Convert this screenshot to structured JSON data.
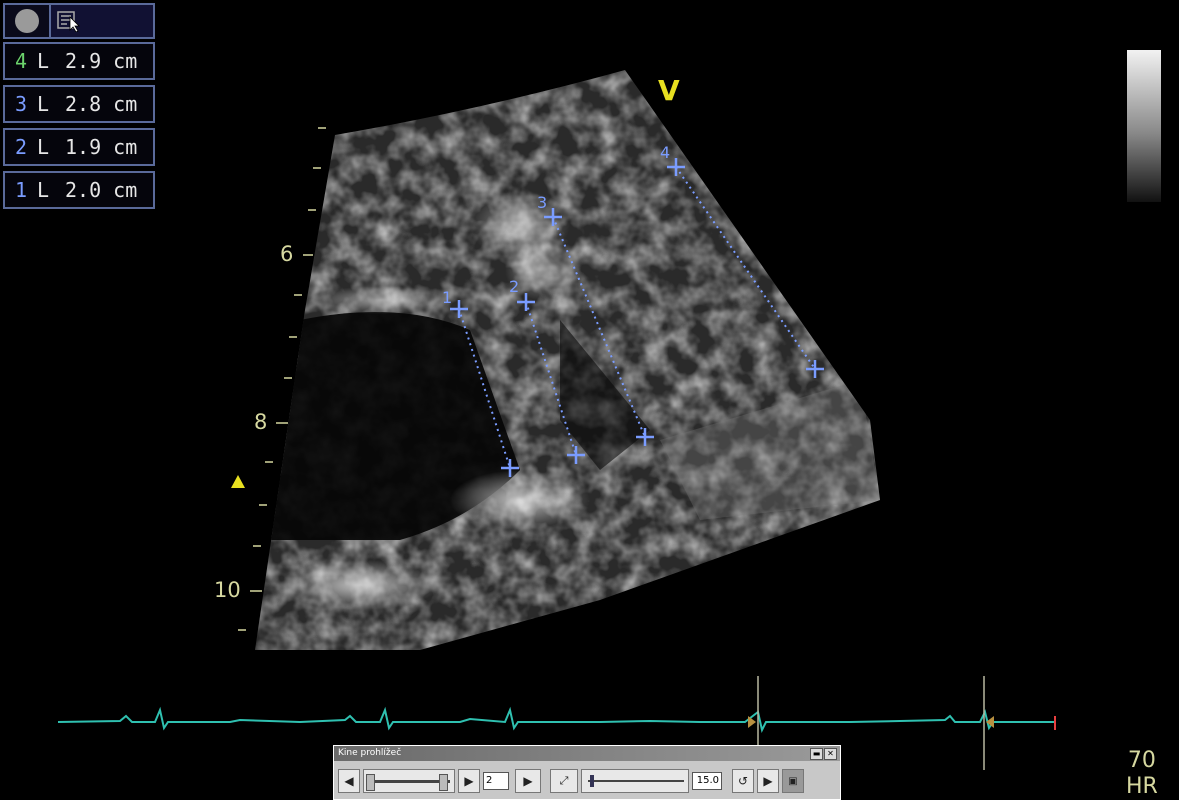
{
  "toolbar": {
    "icons": [
      "record-circle-icon",
      "settings-cursor-icon"
    ]
  },
  "measurements": [
    {
      "index": "4",
      "type": "L",
      "value": "2.9 cm",
      "color": "#6cd36c"
    },
    {
      "index": "3",
      "type": "L",
      "value": "2.8 cm",
      "color": "#7a9cff"
    },
    {
      "index": "2",
      "type": "L",
      "value": "1.9 cm",
      "color": "#7a9cff"
    },
    {
      "index": "1",
      "type": "L",
      "value": "2.0 cm",
      "color": "#7a9cff"
    }
  ],
  "depth_scale": {
    "labels": [
      "6",
      "8",
      "10"
    ]
  },
  "orientation_marker": "V",
  "calipers": {
    "color": "#7a9cff",
    "labels": [
      "1",
      "2",
      "3",
      "4"
    ]
  },
  "heart_rate": {
    "value": "70",
    "unit": "HR"
  },
  "kine": {
    "title": "Kine prohlížeč",
    "frame": "2",
    "speed": "15.0"
  },
  "colors": {
    "ecg": "#2fc0b0",
    "label": "#d6d8a0",
    "marker": "#e8e020"
  }
}
